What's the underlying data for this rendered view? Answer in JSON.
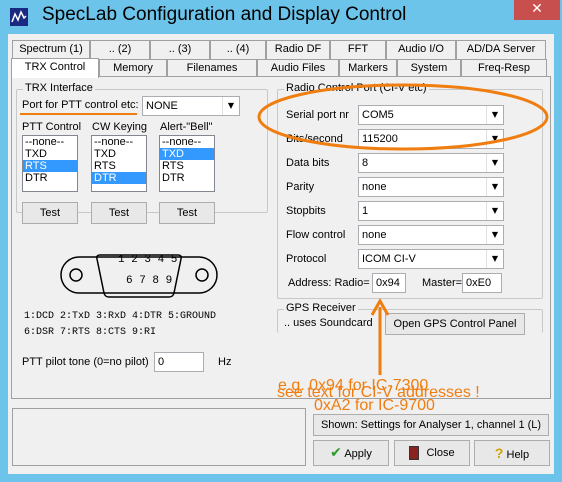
{
  "window": {
    "title": "SpecLab   Configuration and Display Control",
    "close_glyph": "✕",
    "app_icon": "speclab-app-icon"
  },
  "tabs_row1": [
    "Spectrum (1)",
    ".. (2)",
    ".. (3)",
    ".. (4)",
    "Radio DF",
    "FFT",
    "Audio I/O",
    "AD/DA Server"
  ],
  "tabs_row2": [
    "TRX Control",
    "Memory",
    "Filenames",
    "Audio Files",
    "Markers",
    "System",
    "Freq-Resp"
  ],
  "active_tab": "TRX Control",
  "trx": {
    "group_title": "TRX Interface",
    "port_label": "Port for PTT control etc:",
    "port_value": "NONE",
    "ptt_control_label": "PTT Control",
    "cw_keying_label": "CW Keying",
    "alert_label": "Alert-\"Bell\"",
    "ptt_items": [
      "--none--",
      "TXD",
      "RTS",
      "DTR"
    ],
    "ptt_selected": "RTS",
    "cw_items": [
      "--none--",
      "TXD",
      "RTS",
      "DTR"
    ],
    "cw_selected": "DTR",
    "alert_items": [
      "--none--",
      "TXD",
      "RTS",
      "DTR"
    ],
    "alert_selected": "TXD",
    "test_label": "Test"
  },
  "connector": {
    "pins_top": "1 2 3 4 5",
    "pins_bottom": "6 7 8 9",
    "legend_line1": "1:DCD 2:TxD 3:RxD 4:DTR 5:GROUND",
    "legend_line2": "6:DSR 7:RTS 8:CTS 9:RI"
  },
  "pilot": {
    "label": "PTT pilot tone (0=no pilot)",
    "value": "0",
    "unit": "Hz"
  },
  "radio": {
    "group_title": "Radio Control Port (CI-V etc)",
    "fields": [
      {
        "label": "Serial port nr",
        "value": "COM5"
      },
      {
        "label": "Bits/second",
        "value": "115200"
      },
      {
        "label": "Data bits",
        "value": "8"
      },
      {
        "label": "Parity",
        "value": "none"
      },
      {
        "label": "Stopbits",
        "value": "1"
      },
      {
        "label": "Flow control",
        "value": "none"
      },
      {
        "label": "Protocol",
        "value": "ICOM CI-V"
      }
    ],
    "address_radio_label": "Address: Radio=",
    "address_radio_value": "0x94",
    "master_label": "Master=",
    "master_value": "0xE0"
  },
  "gps": {
    "group_title": "GPS Receiver",
    "uses_label": ".. uses Soundcard",
    "open_button": "Open GPS Control Panel"
  },
  "annotation": {
    "line1": "e.g. 0x94 for IC-7300",
    "line2": "0xA2 for IC-9700",
    "line3": "see text for CI-V addresses !",
    "color": "#f07d10"
  },
  "bottom": {
    "shown_label": "Shown: Settings for Analyser 1, channel 1 (L)",
    "apply_label": "Apply",
    "close_label": "Close",
    "help_label": "Help"
  }
}
